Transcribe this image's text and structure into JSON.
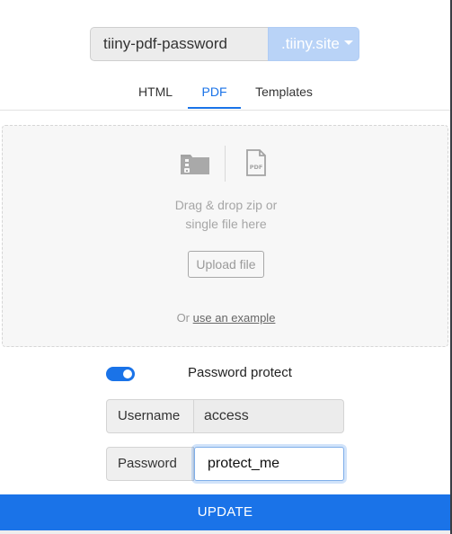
{
  "domain": {
    "subdomain_value": "tiiny-pdf-password",
    "suffix_label": ".tiiny.site"
  },
  "tabs": [
    {
      "label": "HTML",
      "active": false
    },
    {
      "label": "PDF",
      "active": true
    },
    {
      "label": "Templates",
      "active": false
    }
  ],
  "dropzone": {
    "icons": [
      "zip-folder-icon",
      "pdf-file-icon"
    ],
    "instruction_line1": "Drag & drop zip or",
    "instruction_line2": "single file here",
    "upload_label": "Upload file",
    "or_text": "Or",
    "example_link": "use an example"
  },
  "password_protect": {
    "label": "Password protect",
    "enabled": true,
    "username_label": "Username",
    "username_value": "access",
    "password_label": "Password",
    "password_value": "protect_me"
  },
  "update_label": "UPDATE",
  "colors": {
    "accent": "#1a73e8",
    "suffix_bg": "#b9d3f7"
  }
}
